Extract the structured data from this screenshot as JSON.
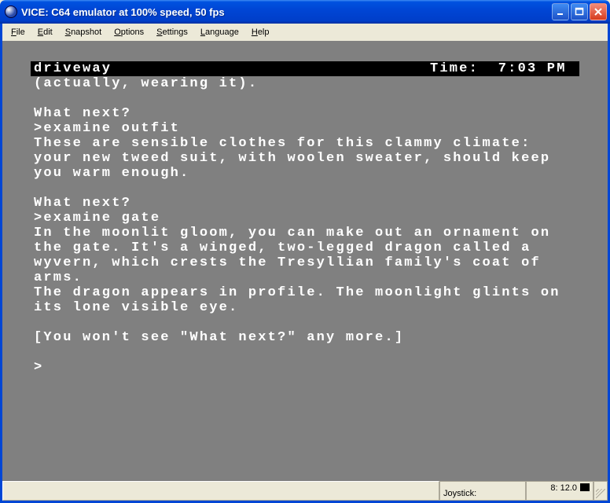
{
  "titlebar": {
    "title": "VICE: C64 emulator at 100% speed, 50 fps"
  },
  "menubar": {
    "items": [
      {
        "text": "File",
        "ul": 0
      },
      {
        "text": "Edit",
        "ul": 0
      },
      {
        "text": "Snapshot",
        "ul": 0
      },
      {
        "text": "Options",
        "ul": 0
      },
      {
        "text": "Settings",
        "ul": 0
      },
      {
        "text": "Language",
        "ul": 0
      },
      {
        "text": "Help",
        "ul": 0
      }
    ]
  },
  "game": {
    "status": {
      "location": "driveway",
      "time_label": "Time:  7:03 PM "
    },
    "line_after_status": "(actually, wearing it).",
    "blocks": [
      [
        "What next?",
        ">examine outfit",
        "These are sensible clothes for this clammy climate: your new tweed suit, with woolen sweater, should keep you warm enough."
      ],
      [
        "What next?",
        ">examine gate",
        "In the moonlit gloom, you can make out an ornament on the gate. It's a winged, two-legged dragon called a wyvern, which crests the Tresyllian family's coat of arms.",
        "The dragon appears in profile. The moonlight glints on its lone visible eye."
      ],
      [
        "[You won't see \"What next?\" any more.]"
      ],
      [
        ">"
      ]
    ]
  },
  "statusbar": {
    "joystick_label": "Joystick:",
    "drive_label": "8: 12.0"
  }
}
